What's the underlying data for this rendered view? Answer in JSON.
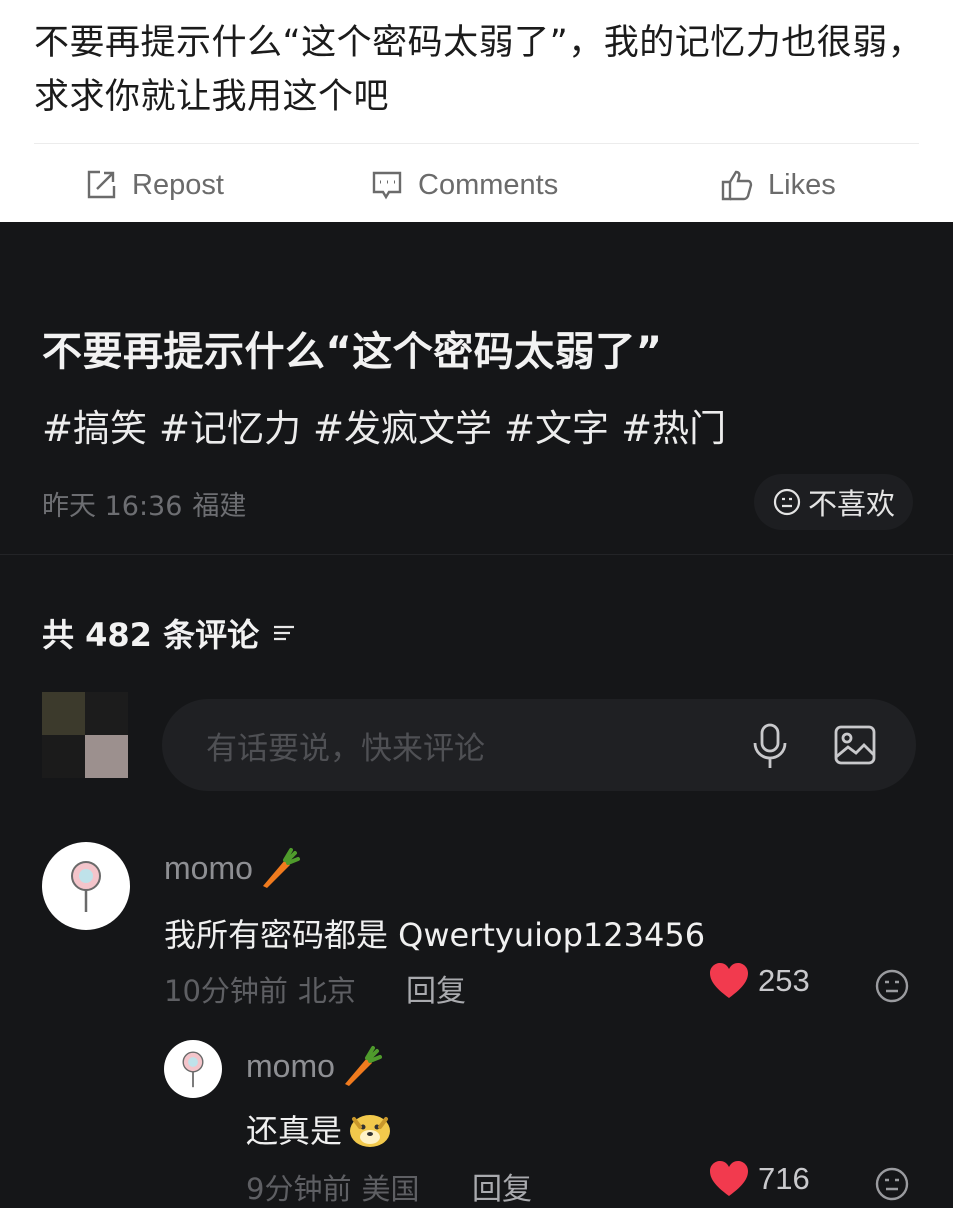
{
  "post": {
    "text": "不要再提示什么“这个密码太弱了”，我的记忆力也很弱，求求你就让我用这个吧",
    "actions": {
      "repost": "Repost",
      "comments": "Comments",
      "likes": "Likes"
    }
  },
  "video": {
    "title": "不要再提示什么“这个密码太弱了”",
    "tags": [
      "#搞笑",
      "#记忆力",
      "#发疯文学",
      "#文字",
      "#热门"
    ],
    "time": "昨天 16:36",
    "location": "福建",
    "dislike_label": "不喜欢"
  },
  "comments_header": {
    "label": "共 482 条评论"
  },
  "input": {
    "placeholder": "有话要说，快来评论"
  },
  "comments": [
    {
      "username": "momo",
      "text": "我所有密码都是 Qwertyuiop123456",
      "time": "10分钟前",
      "location": "北京",
      "reply_label": "回复",
      "likes": "253"
    },
    {
      "username": "momo",
      "text": "还真是",
      "time": "9分钟前",
      "location": "美国",
      "reply_label": "回复",
      "likes": "716"
    }
  ],
  "colors": {
    "dark_bg": "#151618",
    "heart": "#f23a4e"
  }
}
